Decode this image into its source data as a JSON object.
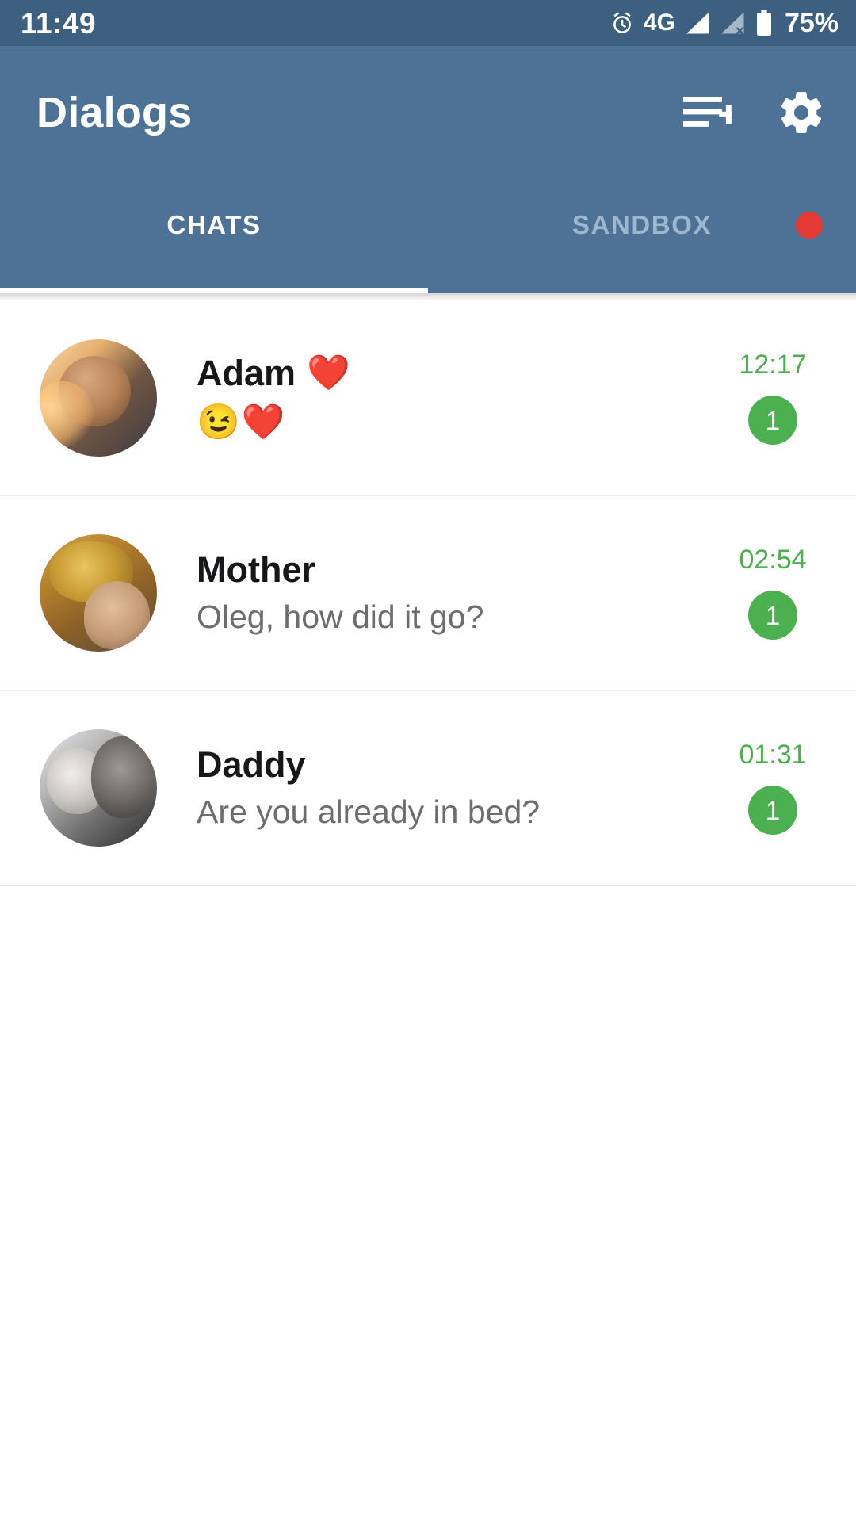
{
  "status_bar": {
    "time": "11:49",
    "network": "4G",
    "battery_percent": "75%",
    "icons": [
      "alarm-icon",
      "signal-icon-sim1",
      "signal-icon-sim2-off",
      "battery-icon"
    ],
    "background_color": "#3d5f80"
  },
  "app_bar": {
    "title": "Dialogs",
    "background_color": "#4d7296",
    "actions": [
      {
        "name": "new-chat-icon",
        "label": "New chat"
      },
      {
        "name": "settings-gear-icon",
        "label": "Settings"
      }
    ]
  },
  "tabs": {
    "active_index": 0,
    "indicator_color": "#ffffff",
    "items": [
      {
        "label": "CHATS",
        "active": true,
        "badge": false
      },
      {
        "label": "SANDBOX",
        "active": false,
        "badge": true
      }
    ],
    "badge_color": "#e53935"
  },
  "chat_list": {
    "time_color": "#4caf50",
    "badge_color": "#4caf50",
    "rows": [
      {
        "name": "Adam",
        "name_emoji": "❤️",
        "preview": "😉❤️",
        "preview_is_emoji": true,
        "time": "12:17",
        "unread": "1",
        "avatar": "av-adam",
        "avatar_name": "avatar-adam"
      },
      {
        "name": "Mother",
        "name_emoji": "",
        "preview": "Oleg, how did it go?",
        "preview_is_emoji": false,
        "time": "02:54",
        "unread": "1",
        "avatar": "av-mother",
        "avatar_name": "avatar-mother"
      },
      {
        "name": "Daddy",
        "name_emoji": "",
        "preview": "Are you already in bed?",
        "preview_is_emoji": false,
        "time": "01:31",
        "unread": "1",
        "avatar": "av-daddy",
        "avatar_name": "avatar-daddy"
      }
    ]
  }
}
